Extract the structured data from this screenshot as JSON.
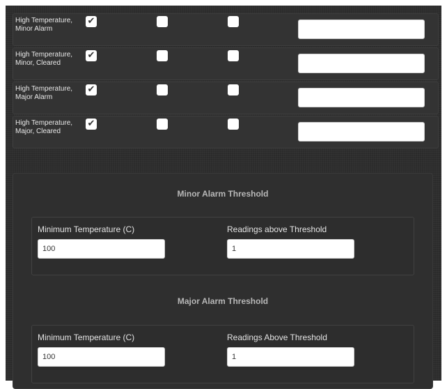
{
  "alarm_rows": [
    {
      "label": "High Temperature, Minor Alarm",
      "checks": [
        true,
        false,
        false
      ],
      "value": ""
    },
    {
      "label": "High Temperature, Minor, Cleared",
      "checks": [
        true,
        false,
        false
      ],
      "value": ""
    },
    {
      "label": "High Temperature, Major Alarm",
      "checks": [
        true,
        false,
        false
      ],
      "value": ""
    },
    {
      "label": "High Temperature, Major, Cleared",
      "checks": [
        true,
        false,
        false
      ],
      "value": ""
    }
  ],
  "minor_threshold": {
    "title": "Minor Alarm Threshold",
    "min_temp_label": "Minimum Temperature (C)",
    "min_temp_value": "100",
    "readings_label": "Readings above Threshold",
    "readings_value": "1"
  },
  "major_threshold": {
    "title": "Major Alarm Threshold",
    "min_temp_label": "Minimum Temperature (C)",
    "min_temp_value": "100",
    "readings_label": "Readings Above Threshold",
    "readings_value": "1"
  },
  "icons": {
    "checkmark": "check-icon"
  },
  "colors": {
    "background": "#2b2b2b",
    "row_background": "#333333",
    "section_title": "#b8b8b8"
  }
}
